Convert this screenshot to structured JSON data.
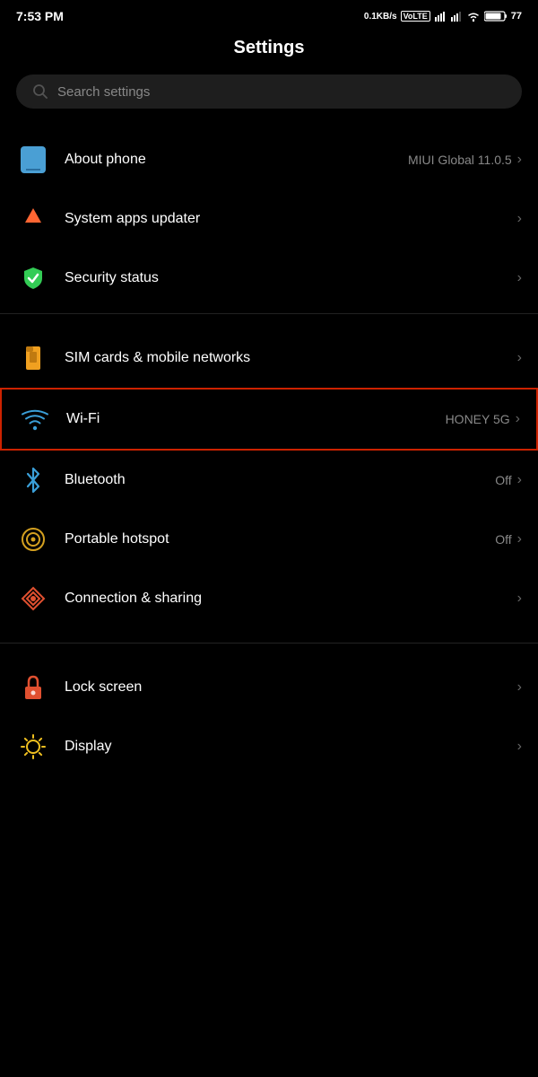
{
  "statusBar": {
    "time": "7:53 PM",
    "speed": "0.1KB/s",
    "battery": "77",
    "batteryIcon": "battery-icon"
  },
  "page": {
    "title": "Settings"
  },
  "search": {
    "placeholder": "Search settings"
  },
  "items": [
    {
      "id": "about-phone",
      "label": "About phone",
      "rightText": "MIUI Global 11.0.5",
      "icon": "phone-icon",
      "hasChevron": true,
      "highlighted": false
    },
    {
      "id": "system-apps-updater",
      "label": "System apps updater",
      "rightText": "",
      "icon": "update-arrow-icon",
      "hasChevron": true,
      "highlighted": false
    },
    {
      "id": "security-status",
      "label": "Security status",
      "rightText": "",
      "icon": "shield-check-icon",
      "hasChevron": true,
      "highlighted": false
    },
    {
      "id": "divider-1",
      "type": "divider"
    },
    {
      "id": "sim-cards",
      "label": "SIM cards & mobile networks",
      "rightText": "",
      "icon": "sim-icon",
      "hasChevron": true,
      "highlighted": false
    },
    {
      "id": "wifi",
      "label": "Wi-Fi",
      "rightText": "HONEY 5G",
      "icon": "wifi-icon",
      "hasChevron": true,
      "highlighted": true
    },
    {
      "id": "bluetooth",
      "label": "Bluetooth",
      "rightText": "Off",
      "icon": "bluetooth-icon",
      "hasChevron": true,
      "highlighted": false
    },
    {
      "id": "portable-hotspot",
      "label": "Portable hotspot",
      "rightText": "Off",
      "icon": "hotspot-icon",
      "hasChevron": true,
      "highlighted": false
    },
    {
      "id": "connection-sharing",
      "label": "Connection & sharing",
      "rightText": "",
      "icon": "connection-icon",
      "hasChevron": true,
      "highlighted": false
    },
    {
      "id": "divider-2",
      "type": "divider"
    },
    {
      "id": "lock-screen",
      "label": "Lock screen",
      "rightText": "",
      "icon": "lock-icon",
      "hasChevron": true,
      "highlighted": false
    },
    {
      "id": "display",
      "label": "Display",
      "rightText": "",
      "icon": "display-icon",
      "hasChevron": true,
      "highlighted": false
    }
  ],
  "chevronChar": "›"
}
